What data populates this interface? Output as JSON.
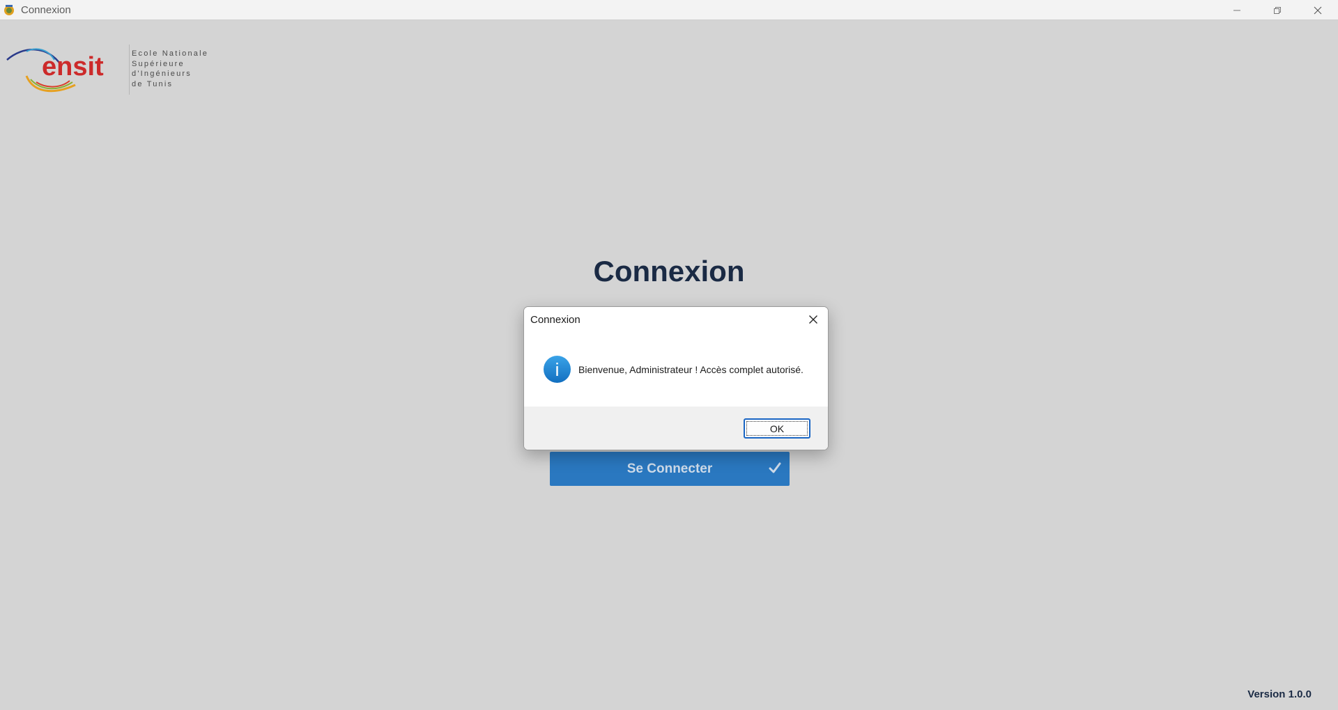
{
  "window": {
    "title": "Connexion",
    "app_icon": "app-icon",
    "controls": [
      "minimize-icon",
      "restore-icon",
      "close-icon"
    ]
  },
  "logo": {
    "wordmark": "ensit",
    "lines": [
      "Ecole Nationale",
      "Supérieure",
      "d'Ingénieurs",
      "de Tunis"
    ]
  },
  "main": {
    "heading": "Connexion",
    "connect_button_label": "Se Connecter",
    "connect_button_icon": "check-icon",
    "version": "Version 1.0.0"
  },
  "dialog": {
    "title": "Connexion",
    "icon": "info-icon",
    "message": "Bienvenue, Administrateur ! Accès complet autorisé.",
    "ok_label": "OK"
  },
  "colors": {
    "background": "#d4d4d4",
    "accent": "#2a78c0",
    "heading": "#1a2a44",
    "info_blue": "#1f86d6"
  }
}
